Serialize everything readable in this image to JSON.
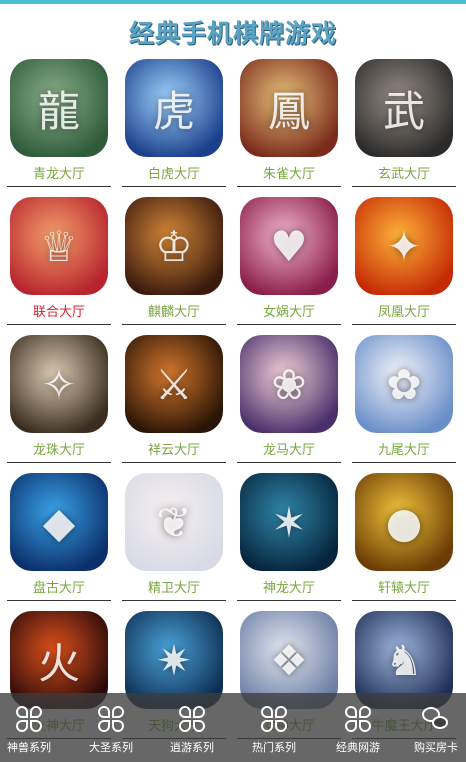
{
  "header": {
    "title": "经典手机棋牌游戏"
  },
  "games": [
    {
      "label": "青龙大厅",
      "icon": "dragon-icon",
      "color_a": "#2f5b3a",
      "color_b": "#8bb08a"
    },
    {
      "label": "白虎大厅",
      "icon": "tiger-icon",
      "color_a": "#1b3f8a",
      "color_b": "#9fd3ff"
    },
    {
      "label": "朱雀大厅",
      "icon": "phoenix-icon",
      "color_a": "#7a2b1c",
      "color_b": "#e8c27a"
    },
    {
      "label": "玄武大厅",
      "icon": "warrior-icon",
      "color_a": "#2b2b2b",
      "color_b": "#9a8f86"
    },
    {
      "label": "联合大厅",
      "icon": "heroine-icon",
      "color_a": "#b7242e",
      "color_b": "#f5a06b",
      "red": true
    },
    {
      "label": "麒麟大厅",
      "icon": "hero-icon",
      "color_a": "#3a1a0d",
      "color_b": "#d7883a"
    },
    {
      "label": "女娲大厅",
      "icon": "girl-icon",
      "color_a": "#8a1e4a",
      "color_b": "#f3b4cf"
    },
    {
      "label": "凤凰大厅",
      "icon": "firebird-icon",
      "color_a": "#c42a05",
      "color_b": "#ffb339"
    },
    {
      "label": "龙珠大厅",
      "icon": "elf-icon",
      "color_a": "#3b2d1f",
      "color_b": "#d9cbb2"
    },
    {
      "label": "祥云大厅",
      "icon": "sword-icon",
      "color_a": "#2a1506",
      "color_b": "#d5772c"
    },
    {
      "label": "龙马大厅",
      "icon": "doll-icon",
      "color_a": "#4b2f6b",
      "color_b": "#f2d1d8"
    },
    {
      "label": "九尾大厅",
      "icon": "fairy-icon",
      "color_a": "#6a8fc8",
      "color_b": "#f4f4fb"
    },
    {
      "label": "盘古大厅",
      "icon": "emblem-icon",
      "color_a": "#0b2f6a",
      "color_b": "#3aa3e8"
    },
    {
      "label": "精卫大厅",
      "icon": "dancer-icon",
      "color_a": "#d8dbe6",
      "color_b": "#f6eef0"
    },
    {
      "label": "神龙大厅",
      "icon": "beast-icon",
      "color_a": "#07243d",
      "color_b": "#2f87a8"
    },
    {
      "label": "轩辕大厅",
      "icon": "ball-icon",
      "color_a": "#6b3c05",
      "color_b": "#f0c43b"
    },
    {
      "label": "火神大厅",
      "icon": "firegod-icon",
      "color_a": "#2b0a0a",
      "color_b": "#e0521c"
    },
    {
      "label": "天狗大厅",
      "icon": "wolf-icon",
      "color_a": "#0e2d52",
      "color_b": "#4aa3d9"
    },
    {
      "label": "女神大厅",
      "icon": "goddess-icon",
      "color_a": "#6c7ea5",
      "color_b": "#e2e6f0"
    },
    {
      "label": "牛魔王大厅",
      "icon": "demon-icon",
      "color_a": "#1f2f55",
      "color_b": "#9eb6de"
    }
  ],
  "bottom_nav": [
    {
      "label": "神兽系列",
      "icon": "clover-icon"
    },
    {
      "label": "大圣系列",
      "icon": "clover-icon"
    },
    {
      "label": "逍游系列",
      "icon": "clover-icon"
    },
    {
      "label": "热门系列",
      "icon": "clover-icon"
    },
    {
      "label": "经典网游",
      "icon": "clover-icon"
    },
    {
      "label": "购买房卡",
      "icon": "wechat-icon"
    }
  ]
}
